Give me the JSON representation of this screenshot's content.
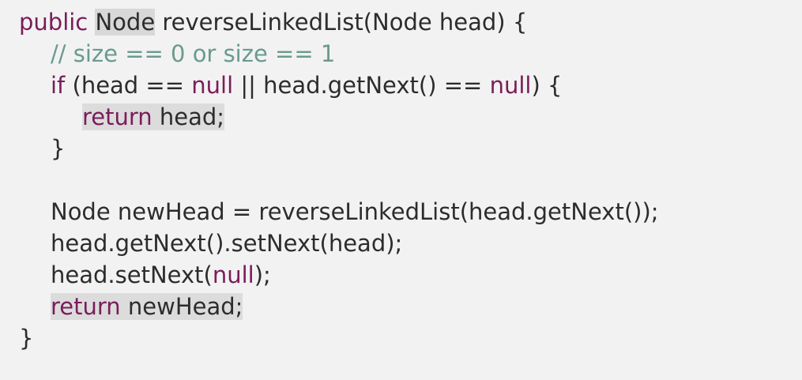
{
  "code": {
    "line1": {
      "kw_public": "public",
      "type_node": "Node",
      "sig_rest": " reverseLinkedList(Node head) {"
    },
    "line2": {
      "comment": "// size == 0 or size == 1"
    },
    "line3": {
      "kw_if": "if",
      "open": " (head == ",
      "null1": "null",
      "mid": " || head.getNext() == ",
      "null2": "null",
      "close": ") {"
    },
    "line4": {
      "kw_return": "return",
      "rest": " head;"
    },
    "line5": {
      "brace": "}"
    },
    "line7": {
      "decl": "Node newHead = reverseLinkedList(head.getNext());"
    },
    "line8": {
      "stmt": "head.getNext().setNext(head);"
    },
    "line9": {
      "prefix": "head.setNext(",
      "null": "null",
      "suffix": ");"
    },
    "line10": {
      "kw_return": "return",
      "rest": " newHead;"
    },
    "line11": {
      "brace": "}"
    }
  },
  "colors": {
    "background": "#f2f2f2",
    "keyword": "#7a1d5a",
    "comment": "#6a9a8e",
    "text": "#2c2c2c",
    "highlight": "#dcdcdc"
  }
}
